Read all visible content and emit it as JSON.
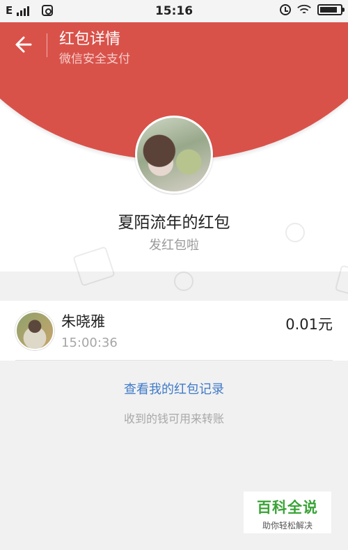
{
  "status_bar": {
    "network": "E",
    "time": "15:16",
    "signal_level": 4,
    "battery_level": 0.8
  },
  "header": {
    "title": "红包详情",
    "subtitle": "微信安全支付",
    "back_icon": "back-arrow-icon",
    "background_color": "#d9524a"
  },
  "sender": {
    "name": "夏陌流年的红包",
    "greeting": "发红包啦"
  },
  "recipients": [
    {
      "name": "朱晓雅",
      "time": "15:00:36",
      "amount": "0.01元"
    }
  ],
  "footer": {
    "records_link": "查看我的红包记录",
    "note": "收到的钱可用来转账"
  },
  "watermark": {
    "title": "百科全说",
    "subtitle": "助你轻松解决"
  }
}
